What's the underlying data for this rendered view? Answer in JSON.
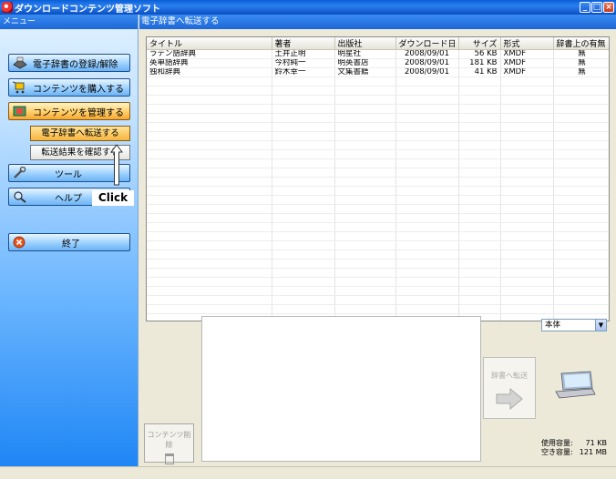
{
  "window": {
    "title": "ダウンロードコンテンツ管理ソフト"
  },
  "sidebar": {
    "header": "メニュー",
    "items": [
      {
        "label": "電子辞書の登録/解除",
        "icon": "dictionary-register-icon"
      },
      {
        "label": "コンテンツを購入する",
        "icon": "shopping-cart-icon"
      },
      {
        "label": "コンテンツを管理する",
        "icon": "manage-contents-icon"
      },
      {
        "label": "ツール",
        "icon": "tools-icon"
      },
      {
        "label": "ヘルプ",
        "icon": "magnifier-icon"
      },
      {
        "label": "終了",
        "icon": "exit-icon"
      }
    ],
    "subitems": [
      {
        "label": "電子辞書へ転送する"
      },
      {
        "label": "転送結果を確認する"
      }
    ],
    "callout": "Click"
  },
  "main": {
    "header": "電子辞書へ転送する",
    "columns": [
      "タイトル",
      "著者",
      "出版社",
      "ダウンロード日",
      "サイズ",
      "形式",
      "辞書上の有無"
    ],
    "rows": [
      [
        "ラテン語辞典",
        "土井正明",
        "明星社",
        "2008/09/01",
        "56 KB",
        "XMDF",
        "無"
      ],
      [
        "英単語辞典",
        "今村純一",
        "明英書店",
        "2008/09/01",
        "181 KB",
        "XMDF",
        "無"
      ],
      [
        "独和辞典",
        "鈴木幸一",
        "文集書籍",
        "2008/09/01",
        "41 KB",
        "XMDF",
        "無"
      ]
    ],
    "delete_label": "コンテンツ削除",
    "transfer_label": "辞書へ転送",
    "target": {
      "selected": "本体"
    },
    "capacity": {
      "used_label": "使用容量:",
      "used_value": "71 KB",
      "free_label": "空き容量:",
      "free_value": "121 MB"
    }
  }
}
